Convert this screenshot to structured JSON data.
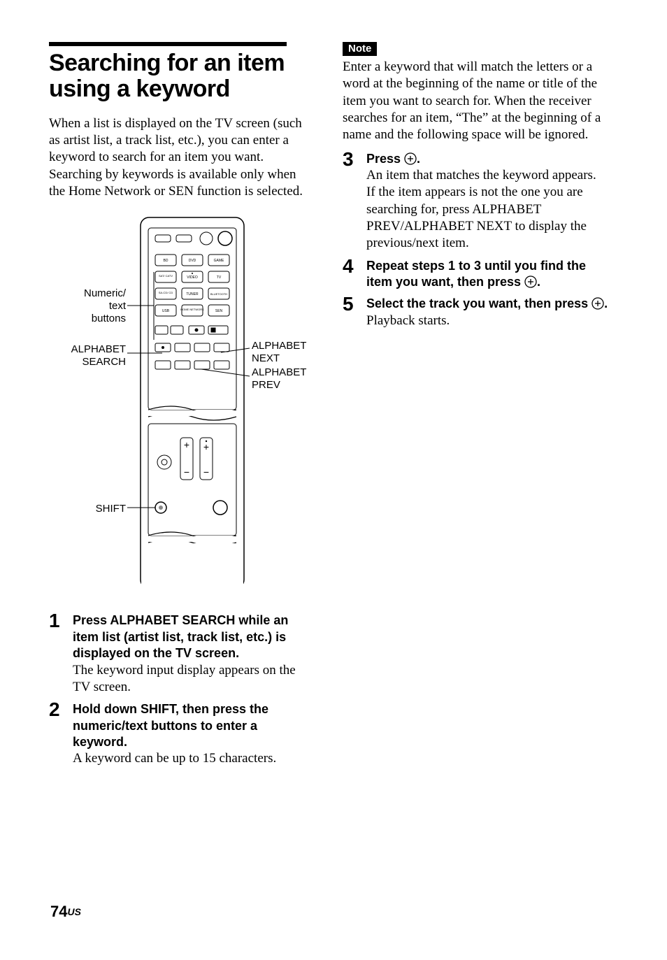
{
  "title": "Searching for an item using a keyword",
  "intro": "When a list is displayed on the TV screen (such as artist list, a track list, etc.), you can enter a keyword to search for an item you want.\nSearching by keywords is available only when the Home Network or SEN function is selected.",
  "remote": {
    "callouts": {
      "numeric": "Numeric/\ntext\nbuttons",
      "alphabet_search": "ALPHABET\nSEARCH",
      "shift": "SHIFT",
      "alphabet_next": "ALPHABET\nNEXT",
      "alphabet_prev": "ALPHABET\nPREV"
    },
    "buttons": {
      "row1": [
        "BD",
        "DVD",
        "GAME"
      ],
      "row2": [
        "SAT/\nCATV",
        "VIDEO",
        "TV"
      ],
      "row3": [
        "SA-CD/\nCD",
        "TUNER",
        "BLUETOOTH"
      ],
      "row4": [
        "USB",
        "HOME\nNETWORK",
        "SEN"
      ]
    }
  },
  "steps_left": [
    {
      "num": "1",
      "strong": "Press ALPHABET SEARCH while an item list (artist list, track list, etc.) is displayed on the TV screen.",
      "plain": "The keyword input display appears on the TV screen."
    },
    {
      "num": "2",
      "strong": "Hold down SHIFT, then press the numeric/text buttons to enter a keyword.",
      "plain": "A keyword can be up to 15 characters."
    }
  ],
  "note": {
    "label": "Note",
    "text": "Enter a keyword that will match the letters or a word at the beginning of the name or title of the item you want to search for. When the receiver searches for an item, “The” at the beginning of a name and the following space will be ignored."
  },
  "steps_right": [
    {
      "num": "3",
      "strong_pre": "Press ",
      "strong_post": ".",
      "plain": "An item that matches the keyword appears. If the item appears is not the one you are searching for, press ALPHABET PREV/ALPHABET NEXT to display the previous/next item."
    },
    {
      "num": "4",
      "strong_pre": "Repeat steps 1 to 3 until you find the item you want, then press ",
      "strong_post": "."
    },
    {
      "num": "5",
      "strong_pre": "Select the track you want, then press ",
      "strong_post": ".",
      "plain": "Playback starts."
    }
  ],
  "footer": {
    "page": "74",
    "locale": "US"
  }
}
